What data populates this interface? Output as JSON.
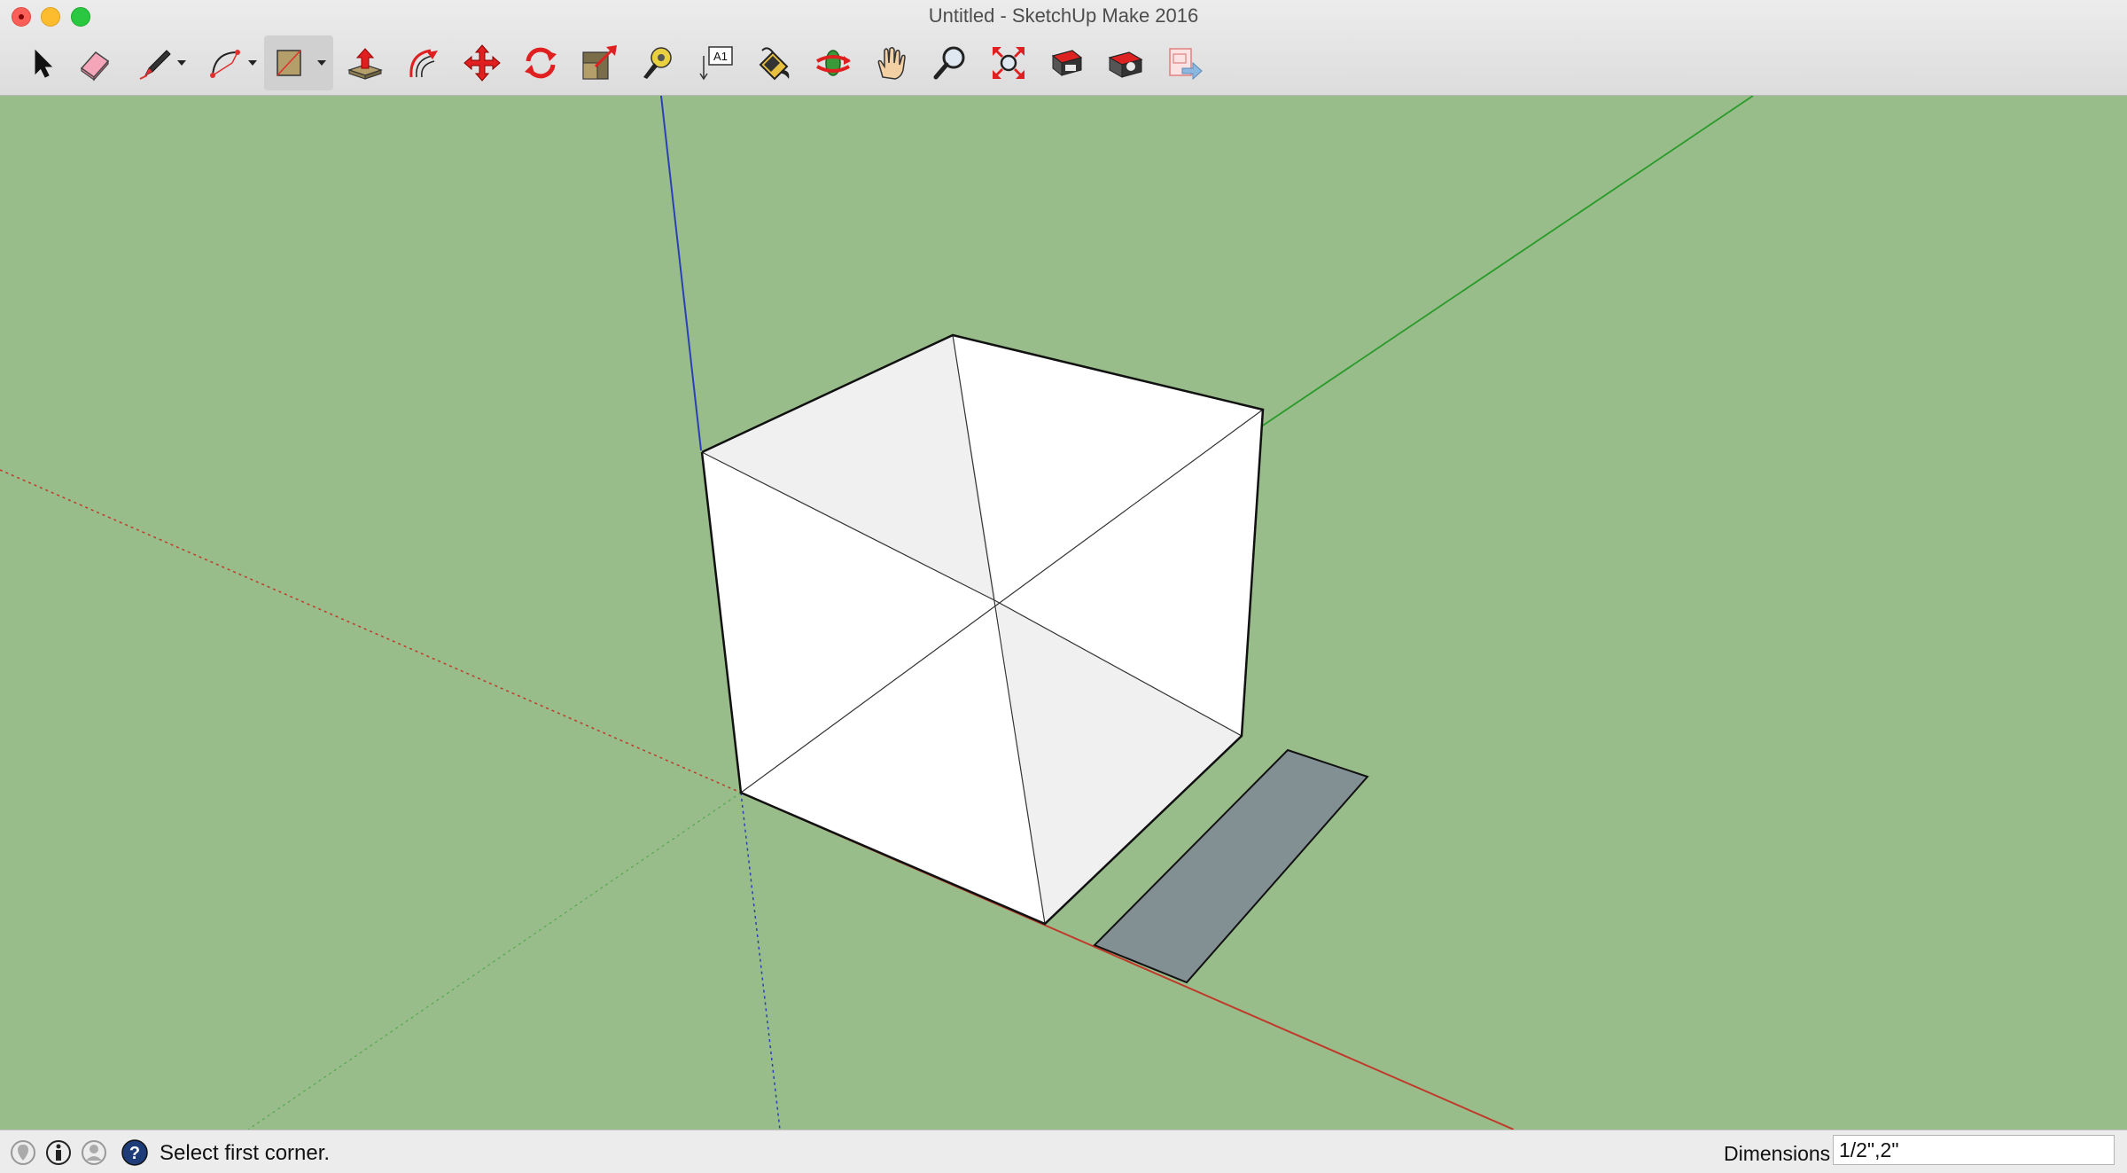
{
  "window": {
    "title": "Untitled - SketchUp Make 2016"
  },
  "toolbar": {
    "tools": [
      {
        "name": "select-tool",
        "icon": "arrow-cursor-icon"
      },
      {
        "name": "eraser-tool",
        "icon": "eraser-icon"
      },
      {
        "name": "line-tool",
        "icon": "pencil-icon",
        "has_dropdown": true
      },
      {
        "name": "arc-tool",
        "icon": "arc-icon",
        "has_dropdown": true
      },
      {
        "name": "rectangle-tool",
        "icon": "rectangle-icon",
        "has_dropdown": true,
        "active": true
      },
      {
        "name": "push-pull-tool",
        "icon": "push-pull-icon"
      },
      {
        "name": "offset-tool",
        "icon": "offset-icon"
      },
      {
        "name": "move-tool",
        "icon": "move-arrows-icon"
      },
      {
        "name": "rotate-tool",
        "icon": "rotate-icon"
      },
      {
        "name": "scale-tool",
        "icon": "scale-icon"
      },
      {
        "name": "tape-measure-tool",
        "icon": "tape-measure-icon"
      },
      {
        "name": "text-tool",
        "icon": "text-label-icon",
        "label": "A1"
      },
      {
        "name": "paint-bucket-tool",
        "icon": "paint-bucket-icon"
      },
      {
        "name": "orbit-tool",
        "icon": "orbit-icon"
      },
      {
        "name": "pan-tool",
        "icon": "hand-icon"
      },
      {
        "name": "zoom-tool",
        "icon": "magnifier-icon"
      },
      {
        "name": "zoom-extents-tool",
        "icon": "zoom-extents-icon"
      },
      {
        "name": "3d-warehouse-tool",
        "icon": "warehouse-icon"
      },
      {
        "name": "extension-warehouse-tool",
        "icon": "extension-warehouse-icon"
      },
      {
        "name": "send-to-layout-tool",
        "icon": "layout-icon"
      }
    ]
  },
  "scene": {
    "colors": {
      "ground": "#98bd8a",
      "red_axis": "#c0392b",
      "green_axis": "#2a9a2a",
      "blue_axis": "#2b3fb8",
      "face_light": "#ffffff",
      "face_shaded": "#f0f0f0",
      "rect_fill": "#828f93"
    }
  },
  "statusbar": {
    "icons": [
      "geo-location-icon",
      "credits-icon",
      "account-icon",
      "help-icon"
    ],
    "message": "Select first corner.",
    "dimensions_label": "Dimensions",
    "dimensions_value": "1/2\",2\""
  }
}
